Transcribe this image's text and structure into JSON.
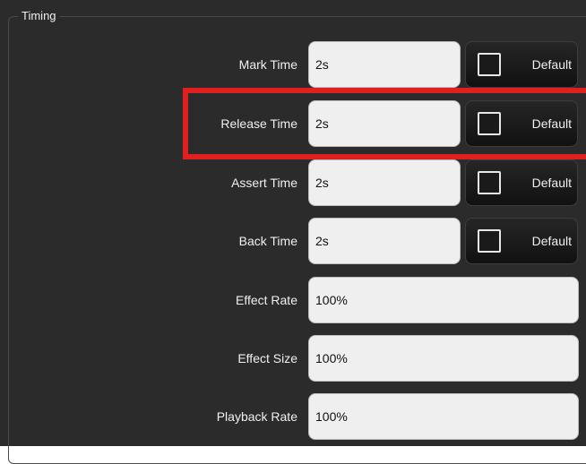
{
  "group": {
    "title": "Timing"
  },
  "rows": [
    {
      "label": "Mark Time",
      "value": "2s",
      "default_label": "Default"
    },
    {
      "label": "Release Time",
      "value": "2s",
      "default_label": "Default"
    },
    {
      "label": "Assert Time",
      "value": "2s",
      "default_label": "Default"
    },
    {
      "label": "Back Time",
      "value": "2s",
      "default_label": "Default"
    },
    {
      "label": "Effect Rate",
      "value": "100%"
    },
    {
      "label": "Effect Size",
      "value": "100%"
    },
    {
      "label": "Playback Rate",
      "value": "100%"
    }
  ],
  "colors": {
    "highlight": "#e0201e",
    "panel_background": "#2b2b2b",
    "field_background": "#efefef"
  }
}
